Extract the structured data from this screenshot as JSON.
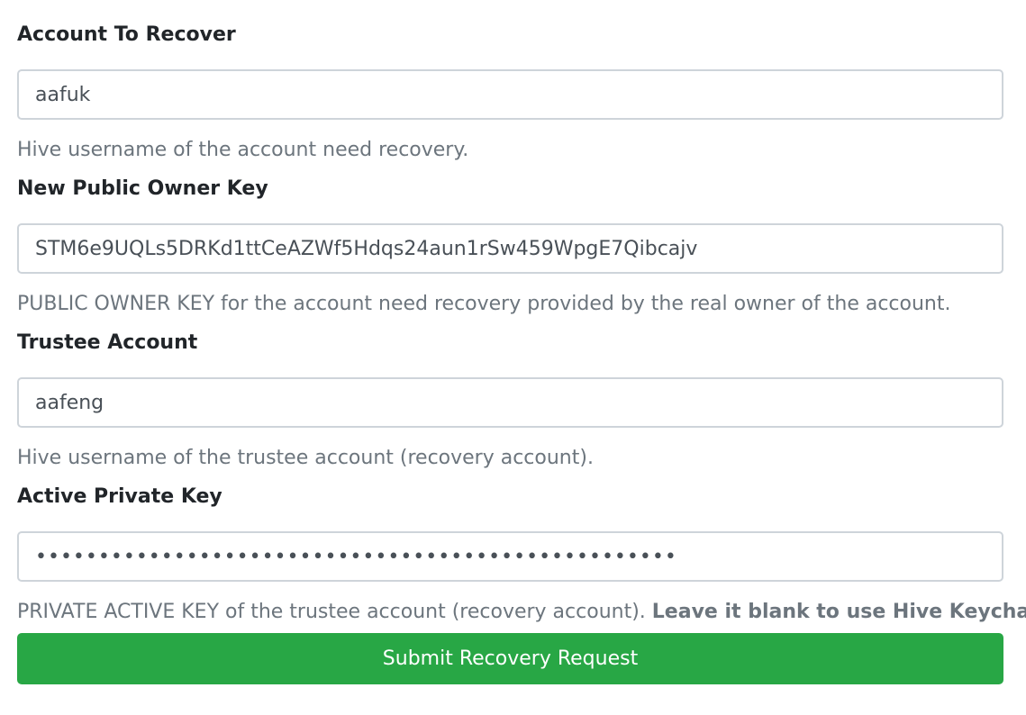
{
  "fields": [
    {
      "label": "Account To Recover",
      "value": "aafuk",
      "help": "Hive username of the account need recovery."
    },
    {
      "label": "New Public Owner Key",
      "value": "STM6e9UQLs5DRKd1ttCeAZWf5Hdqs24aun1rSw459WpgE7Qibcajv",
      "help": "PUBLIC OWNER KEY for the account need recovery provided by the real owner of the account."
    },
    {
      "label": "Trustee Account",
      "value": "aafeng",
      "help": "Hive username of the trustee account (recovery account)."
    },
    {
      "label": "Active Private Key",
      "value": "•••••••••••••••••••••••••••••••••••••••••••••••••••",
      "help": "PRIVATE ACTIVE KEY of the trustee account (recovery account). ",
      "help_bold": "Leave it blank to use Hive Keychain."
    }
  ],
  "submit_label": "Submit Recovery Request",
  "colors": {
    "primary_button": "#28a745",
    "input_border": "#ced4da",
    "help_text": "#6c757d",
    "label_text": "#212529"
  }
}
